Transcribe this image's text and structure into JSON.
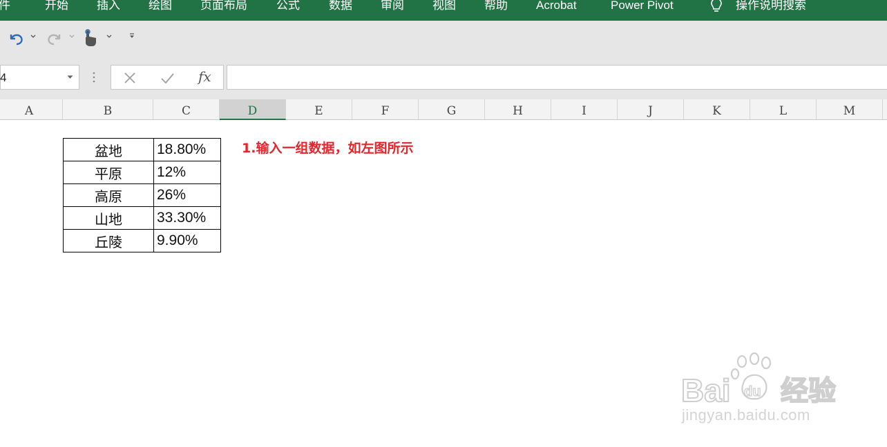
{
  "ribbon": {
    "tabs": [
      {
        "label": "件"
      },
      {
        "label": "开始"
      },
      {
        "label": "插入"
      },
      {
        "label": "绘图"
      },
      {
        "label": "页面布局"
      },
      {
        "label": "公式"
      },
      {
        "label": "数据"
      },
      {
        "label": "审阅"
      },
      {
        "label": "视图"
      },
      {
        "label": "帮助"
      },
      {
        "label": "Acrobat"
      },
      {
        "label": "Power Pivot"
      }
    ],
    "tell_me": "操作说明搜索",
    "accent_color": "#217346"
  },
  "quick_access": {
    "icons": [
      "undo-icon",
      "redo-icon",
      "touch-mode-icon",
      "customize-toolbar-icon"
    ]
  },
  "formula_bar": {
    "name_box_value": "4",
    "fx_label": "fx",
    "formula_value": ""
  },
  "columns": [
    "A",
    "B",
    "C",
    "D",
    "E",
    "F",
    "G",
    "H",
    "I",
    "J",
    "K",
    "L",
    "M"
  ],
  "active_column": "D",
  "table": {
    "rows": [
      {
        "name": "盆地",
        "value": "18.80%"
      },
      {
        "name": "平原",
        "value": "12%"
      },
      {
        "name": "高原",
        "value": "26%"
      },
      {
        "name": "山地",
        "value": "33.30%"
      },
      {
        "name": "丘陵",
        "value": "9.90%"
      }
    ]
  },
  "note": {
    "text": "1.输入一组数据，如左图所示",
    "color": "#e8242b"
  },
  "watermark": {
    "url": "jingyan.baidu.com"
  }
}
